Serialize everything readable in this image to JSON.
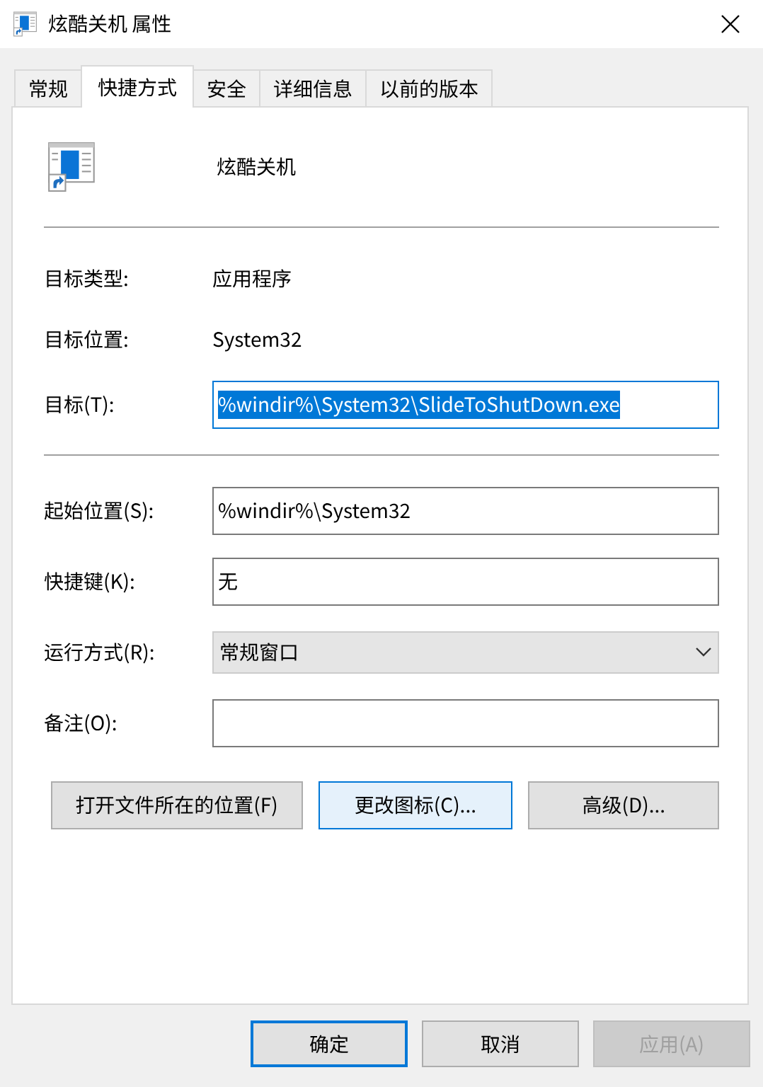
{
  "window": {
    "title": "炫酷关机 属性"
  },
  "tabs": [
    {
      "label": "常规",
      "selected": false
    },
    {
      "label": "快捷方式",
      "selected": true
    },
    {
      "label": "安全",
      "selected": false
    },
    {
      "label": "详细信息",
      "selected": false
    },
    {
      "label": "以前的版本",
      "selected": false
    }
  ],
  "shortcut": {
    "name": "炫酷关机"
  },
  "sections": [
    [
      {
        "kind": "text",
        "label": "目标类型:",
        "value": "应用程序"
      },
      {
        "kind": "text",
        "label": "目标位置:",
        "value": "System32"
      },
      {
        "kind": "field",
        "label": "目标(T):",
        "value": "%windir%\\System32\\SlideToShutDown.exe",
        "focused": true,
        "text_selected": true
      }
    ],
    [
      {
        "kind": "field",
        "label": "起始位置(S):",
        "value": "%windir%\\System32",
        "focused": false,
        "text_selected": false
      },
      {
        "kind": "field",
        "label": "快捷键(K):",
        "value": "无",
        "focused": false,
        "text_selected": false
      },
      {
        "kind": "select",
        "label": "运行方式(R):",
        "value": "常规窗口"
      },
      {
        "kind": "field",
        "label": "备注(O):",
        "focused": false
      }
    ]
  ],
  "buttons": [
    {
      "label": "打开文件所在的位置(F)",
      "highlighted": false
    },
    {
      "label": "更改图标(C)...",
      "highlighted": true
    },
    {
      "label": "高级(D)...",
      "highlighted": false
    }
  ],
  "dialog_buttons": [
    {
      "label": "确定",
      "default": true,
      "disabled": false
    },
    {
      "label": "取消",
      "default": false,
      "disabled": false
    },
    {
      "label": "应用(A)",
      "default": false,
      "disabled": true
    }
  ]
}
